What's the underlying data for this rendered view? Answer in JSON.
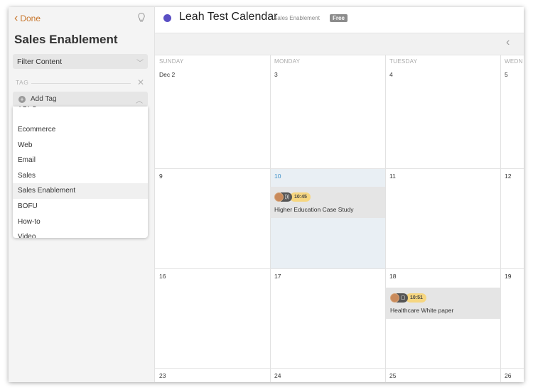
{
  "sidebar": {
    "done_label": "Done",
    "title": "Sales Enablement",
    "filter_label": "Filter Content",
    "tag_label": "TAG",
    "add_tag_label": "Add Tag",
    "tags": [
      "TOFU",
      "Ecommerce",
      "Web",
      "Email",
      "Sales",
      "Sales Enablement",
      "BOFU",
      "How-to",
      "Video"
    ],
    "selected_tag": "Sales Enablement"
  },
  "header": {
    "calendar_name": "Leah Test Calendar",
    "subtitle": "Sales Enablement",
    "badge": "Free",
    "dot_color": "#5a4fc4"
  },
  "calendar": {
    "day_names": [
      "SUNDAY",
      "MONDAY",
      "TUESDAY",
      "WEDN"
    ],
    "rows": [
      [
        "Dec 2",
        "3",
        "4",
        "5"
      ],
      [
        "9",
        "10",
        "11",
        "12"
      ],
      [
        "16",
        "17",
        "18",
        "19"
      ],
      [
        "23",
        "24",
        "25",
        "26"
      ]
    ],
    "today": "10",
    "events": [
      {
        "date": "10",
        "time": "10:45",
        "type_icon": "rss-icon",
        "title": "Higher Education Case Study"
      },
      {
        "date": "18",
        "time": "10:51",
        "type_icon": "document-icon",
        "title": "Healthcare White paper"
      }
    ]
  },
  "colors": {
    "accent": "#c8762c",
    "today": "#3b8fc8",
    "highlight": "#e9eff4",
    "time_pill": "#f6d680"
  }
}
